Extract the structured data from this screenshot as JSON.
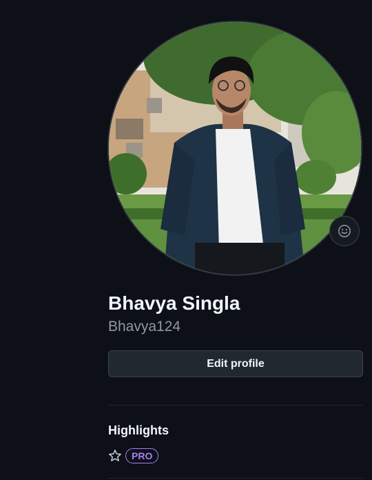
{
  "profile": {
    "display_name": "Bhavya Singla",
    "username": "Bhavya124",
    "avatar_icon": "profile-photo",
    "status_icon": "smiley-icon"
  },
  "actions": {
    "edit_profile_label": "Edit profile"
  },
  "highlights": {
    "title": "Highlights",
    "items": [
      {
        "icon": "star-icon",
        "badge": "PRO"
      }
    ]
  },
  "colors": {
    "background": "#0d1117",
    "text_primary": "#f0f6fc",
    "text_muted": "#9198a1",
    "button_bg": "#212830",
    "border": "#3d444d",
    "pro_accent": "#ab7df8"
  }
}
